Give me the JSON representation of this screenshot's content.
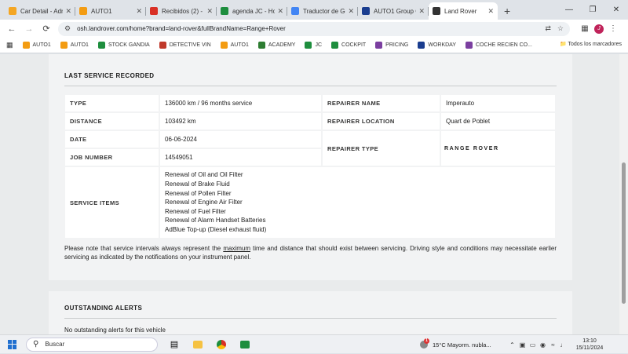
{
  "tabs": [
    {
      "label": "Car Detail - Adm",
      "color": "#f4a623"
    },
    {
      "label": "AUTO1",
      "color": "#f39c12"
    },
    {
      "label": "Recibidos (2) - j",
      "color": "#d93025"
    },
    {
      "label": "agenda JC - Hoja",
      "color": "#1e8e3e"
    },
    {
      "label": "Traductor de Go",
      "color": "#4285f4"
    },
    {
      "label": "AUTO1 Group C",
      "color": "#1a3d8f"
    },
    {
      "label": "Land Rover",
      "color": "#333333"
    }
  ],
  "address_bar": {
    "url": "osh.landrover.com/home?brand=land-rover&fullBrandName=Range+Rover"
  },
  "bookmarks": [
    {
      "label": "AUTO1",
      "color": "#f39c12"
    },
    {
      "label": "AUTO1",
      "color": "#f39c12"
    },
    {
      "label": "STOCK GANDIA",
      "color": "#1e8e3e"
    },
    {
      "label": "DETECTIVE VIN",
      "color": "#c0392b"
    },
    {
      "label": "AUTO1",
      "color": "#f39c12"
    },
    {
      "label": "ACADEMY",
      "color": "#2e7d32"
    },
    {
      "label": "JC",
      "color": "#1e8e3e"
    },
    {
      "label": "COCKPIT",
      "color": "#1e8e3e"
    },
    {
      "label": "PRICING",
      "color": "#7b3fa0"
    },
    {
      "label": "WORKDAY",
      "color": "#1a3d8f"
    },
    {
      "label": "COCHE RECIEN CO...",
      "color": "#7b3fa0"
    }
  ],
  "bookmarks_folder": "Todos los marcadores",
  "last_service": {
    "heading": "LAST SERVICE RECORDED",
    "type_label": "TYPE",
    "type_value": "136000 km / 96 months service",
    "distance_label": "DISTANCE",
    "distance_value": "103492 km",
    "date_label": "DATE",
    "date_value": "06-06-2024",
    "job_label": "JOB NUMBER",
    "job_value": "14549051",
    "repairer_name_label": "REPAIRER NAME",
    "repairer_name_value": "Imperauto",
    "repairer_location_label": "REPAIRER LOCATION",
    "repairer_location_value": "Quart de Poblet",
    "repairer_type_label": "REPAIRER TYPE",
    "repairer_type_logo": "RANGE ROVER",
    "service_items_label": "SERVICE ITEMS",
    "service_items": [
      "Renewal of Oil and Oil Filter",
      "Renewal of Brake Fluid",
      "Renewal of Pollen Filter",
      "Renewal of Engine Air Filter",
      "Renewal of Fuel Filter",
      "Renewal of Alarm Handset Batteries",
      "AdBlue Top-up (Diesel exhaust fluid)"
    ],
    "note_before": "Please note that service intervals always represent the ",
    "note_emphasis": "maximum",
    "note_after": " time and distance that should exist between servicing. Driving style and conditions may necessitate earlier servicing as indicated by the notifications on your instrument panel."
  },
  "outstanding_alerts": {
    "heading": "OUTSTANDING ALERTS",
    "message": "No outstanding alerts for this vehicle"
  },
  "taskbar": {
    "search_label": "Buscar",
    "weather_temp": "15°C",
    "weather_text": "Mayorm. nubla...",
    "weather_badge": "1",
    "time": "13:10",
    "date": "15/11/2024"
  },
  "profile_initial": "J"
}
